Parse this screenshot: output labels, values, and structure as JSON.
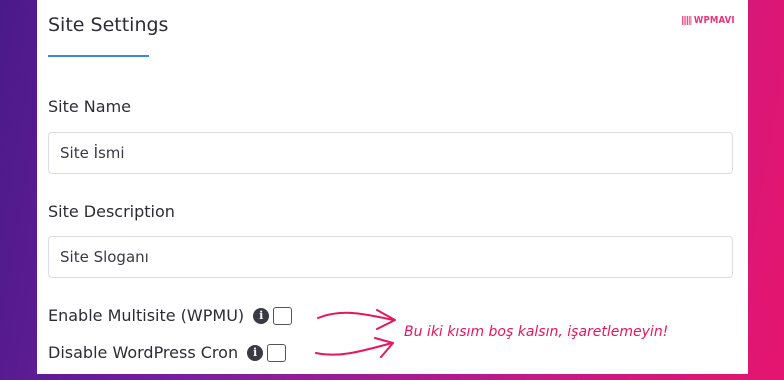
{
  "header": {
    "title": "Site Settings",
    "logo_text": "WPMAVI"
  },
  "fields": {
    "site_name": {
      "label": "Site Name",
      "value": "Site İsmi"
    },
    "site_description": {
      "label": "Site Description",
      "value": "Site Sloganı"
    }
  },
  "options": {
    "multisite": {
      "label": "Enable Multisite (WPMU)",
      "checked": false
    },
    "cron": {
      "label": "Disable WordPress Cron",
      "checked": false
    }
  },
  "annotation": {
    "text": "Bu iki kısım boş kalsın, işaretlemeyin!",
    "color": "#e5155f"
  },
  "colors": {
    "accent": "#3b8ad8",
    "logo": "#e8337a"
  },
  "icons": {
    "info": "info-icon"
  }
}
